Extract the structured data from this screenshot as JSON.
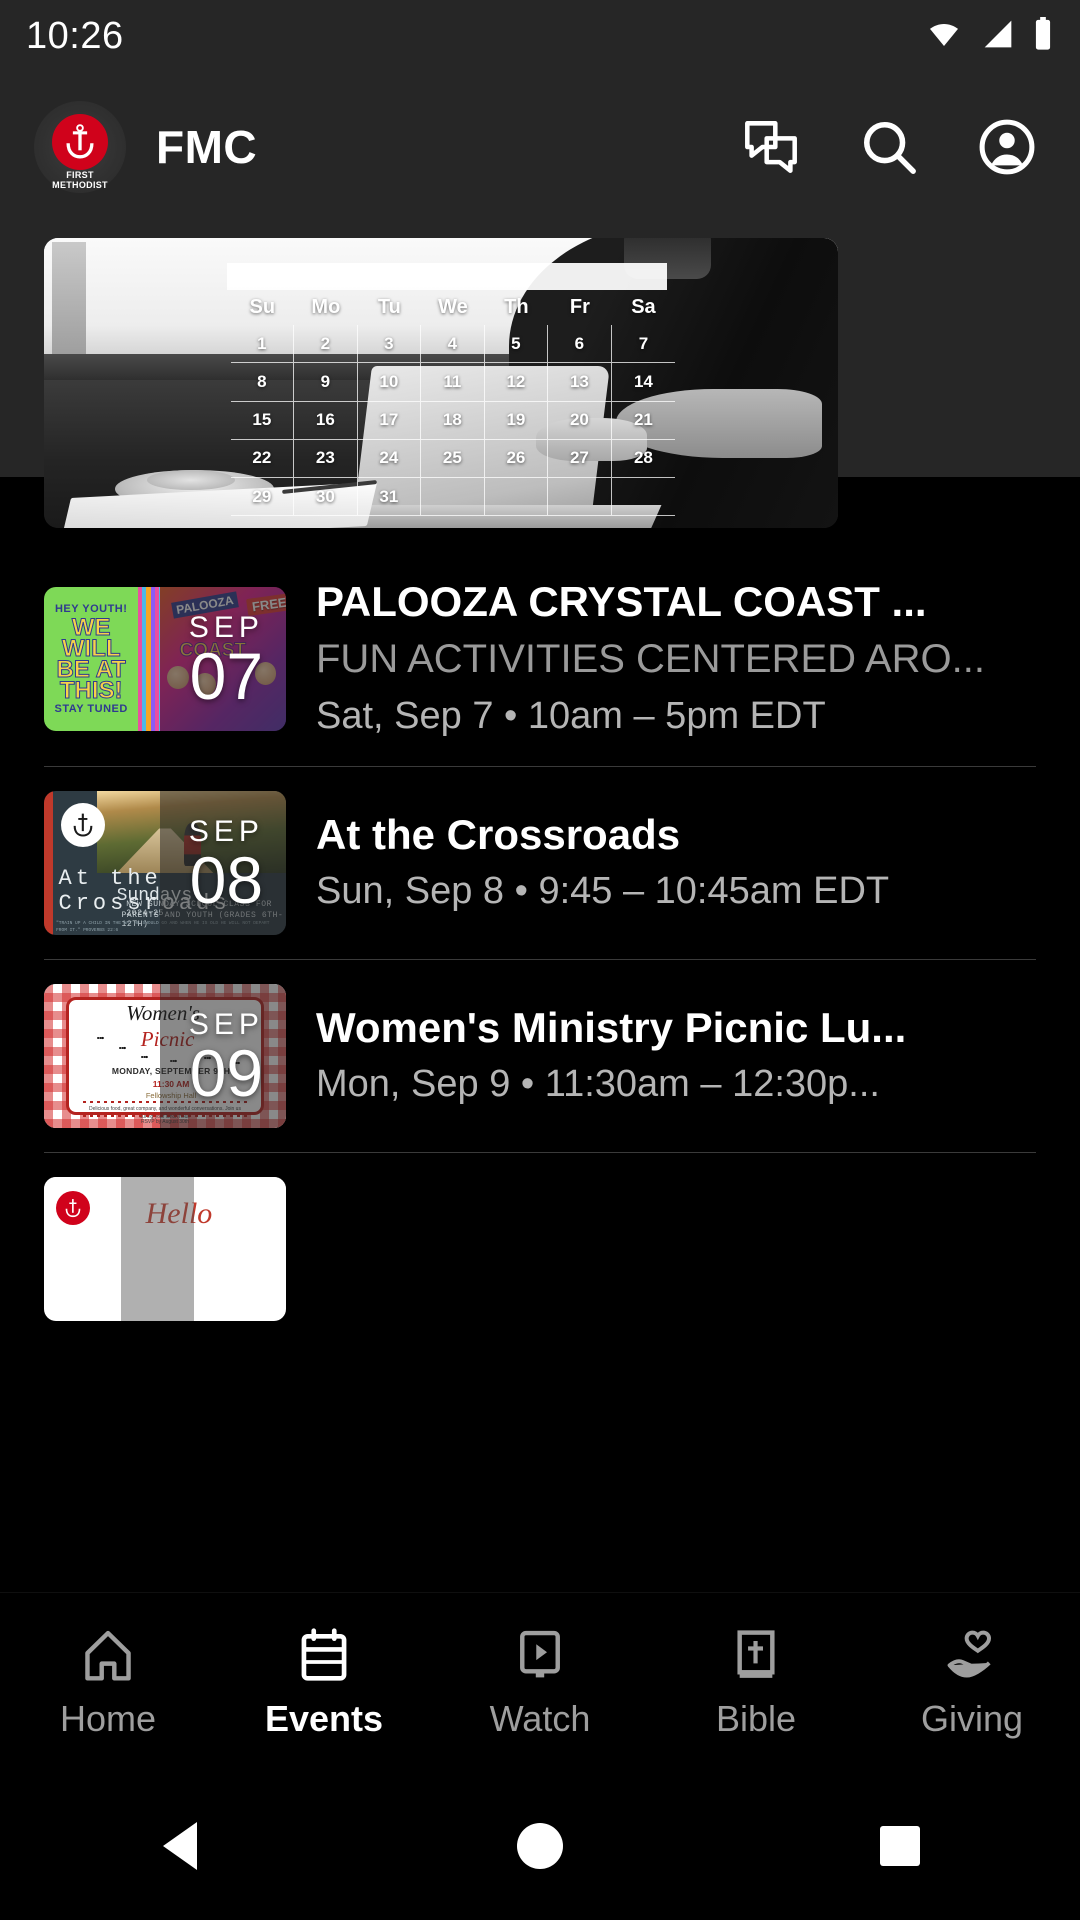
{
  "status_bar": {
    "time": "10:26",
    "icons": [
      "wifi-icon",
      "cellular-signal-icon",
      "battery-icon"
    ]
  },
  "app_bar": {
    "title": "FMC",
    "logo": {
      "name": "first-methodist-logo",
      "line1": "FIRST",
      "line2": "METHODIST",
      "color": "#d0021b"
    },
    "actions": [
      {
        "name": "messages-icon",
        "label": "Messages"
      },
      {
        "name": "search-icon",
        "label": "Search"
      },
      {
        "name": "account-icon",
        "label": "Account"
      }
    ]
  },
  "banner": {
    "name": "events-hero-banner",
    "alt": "Person working on a laptop at a window with a calendar grid overlay",
    "calendar": {
      "weekdays": [
        "Su",
        "Mo",
        "Tu",
        "We",
        "Th",
        "Fr",
        "Sa"
      ],
      "days": [
        "1",
        "2",
        "3",
        "4",
        "5",
        "6",
        "7",
        "8",
        "9",
        "10",
        "11",
        "12",
        "13",
        "14",
        "15",
        "16",
        "17",
        "18",
        "19",
        "20",
        "21",
        "22",
        "23",
        "24",
        "25",
        "26",
        "27",
        "28",
        "29",
        "30",
        "31",
        "",
        "",
        "",
        ""
      ]
    }
  },
  "events": [
    {
      "title": "PALOOZA CRYSTAL COAST ...",
      "description": "FUN ACTIVITIES CENTERED ARO...",
      "time": "Sat, Sep 7 • 10am – 5pm EDT",
      "date_month": "SEP",
      "date_day": "07",
      "thumb": {
        "name": "palooza-crystal-coast-thumbnail",
        "line1": "HEY YOUTH!",
        "line2": "WE WILL BE AT THIS!",
        "line3": "STAY TUNED",
        "badge_free": "FREE",
        "badge_palooza": "PALOOZA",
        "badge_coast": "COAST"
      }
    },
    {
      "title": "At the Crossroads",
      "description": "",
      "time": "Sun, Sep 8 • 9:45 – 10:45am EDT",
      "date_month": "SEP",
      "date_day": "08",
      "thumb": {
        "name": "at-the-crossroads-thumbnail",
        "title_text": "At the Crossroads",
        "subtitle_text": "Sundays",
        "line3": "NEW SUNDAY SCHOOL CLASS FOR 2024-25",
        "line4": "PARENTS AND YOUTH (GRADES 6TH-12TH)",
        "footer": "\"TRAIN UP A CHILD IN THE WAY HE SHOULD GO AND WHEN HE IS OLD HE WILL NOT DEPART FROM IT.\" PROVERBS 22:6"
      }
    },
    {
      "title": "Women's Ministry Picnic Lu...",
      "description": "",
      "time": "Mon, Sep 9 • 11:30am – 12:30p...",
      "date_month": "SEP",
      "date_day": "09",
      "thumb": {
        "name": "womens-ministry-picnic-thumbnail",
        "script1": "Women's",
        "script2": "Picnic",
        "detail1": "MONDAY, SEPTEMBER 9TH",
        "detail2": "11:30 AM",
        "detail3": "Fellowship Hall",
        "body": "Delicious food, great company, and wonderful conversations. Join us during your lunch hour!",
        "footer": "RSVP by August 30th",
        "website": "www.firstmethodist.life"
      }
    },
    {
      "title": "",
      "description": "",
      "time": "",
      "date_month": "",
      "date_day": "",
      "thumb": {
        "name": "partial-event-thumbnail",
        "script1": "Hello"
      }
    }
  ],
  "bottom_nav": {
    "items": [
      {
        "label": "Home",
        "icon": "home-icon",
        "active": false
      },
      {
        "label": "Events",
        "icon": "calendar-icon",
        "active": true
      },
      {
        "label": "Watch",
        "icon": "video-icon",
        "active": false
      },
      {
        "label": "Bible",
        "icon": "bible-icon",
        "active": false
      },
      {
        "label": "Giving",
        "icon": "giving-icon",
        "active": false
      }
    ]
  },
  "system_nav": {
    "back": "back-button",
    "home": "home-button",
    "recents": "recents-button"
  }
}
